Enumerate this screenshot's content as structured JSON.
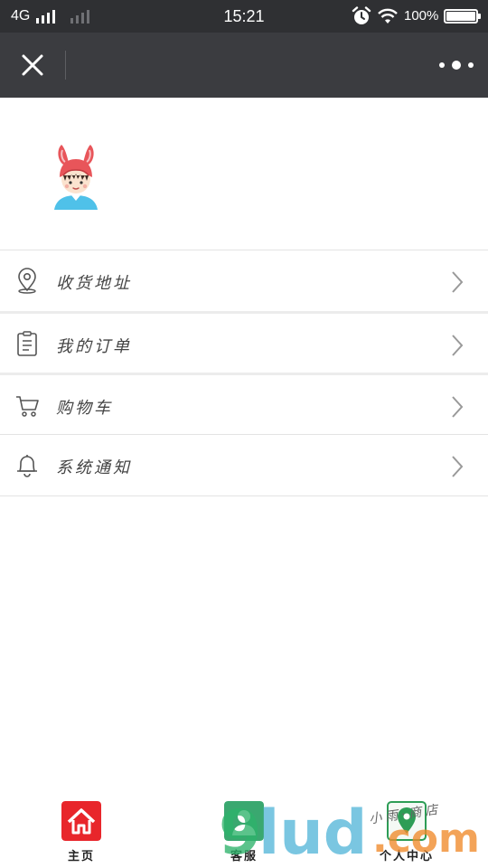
{
  "status_bar": {
    "network": "4G",
    "time": "15:21",
    "battery_percent": "100%",
    "icons": [
      "signal-icon",
      "alarm-icon",
      "wifi-icon",
      "battery-icon"
    ]
  },
  "title_bar": {
    "close_icon": "close-icon",
    "more_icon": "more-dots-icon"
  },
  "profile": {
    "avatar_icon": "bunny-hat-boy-avatar"
  },
  "menu": {
    "items": [
      {
        "label": "收货地址",
        "icon": "location-pin-icon"
      },
      {
        "label": "我的订单",
        "icon": "clipboard-icon"
      },
      {
        "label": "购物车",
        "icon": "cart-icon"
      },
      {
        "label": "系统通知",
        "icon": "bell-icon"
      }
    ]
  },
  "bottom_nav": {
    "items": [
      {
        "label": "主页",
        "icon": "home-icon",
        "color": "#e8262b"
      },
      {
        "label": "客服",
        "icon": "service-icon",
        "color": "#3aa870"
      },
      {
        "label": "个人中心",
        "icon": "map-pin-icon",
        "color": "#2d9d56"
      }
    ]
  },
  "watermark": {
    "text": "9lud.com",
    "sub": "小雨·商店"
  },
  "colors": {
    "status_bar_bg": "#2f3033",
    "title_bar_bg": "#3b3c40",
    "home_red": "#e8262b",
    "avatar_blue": "#4fc1e9"
  }
}
